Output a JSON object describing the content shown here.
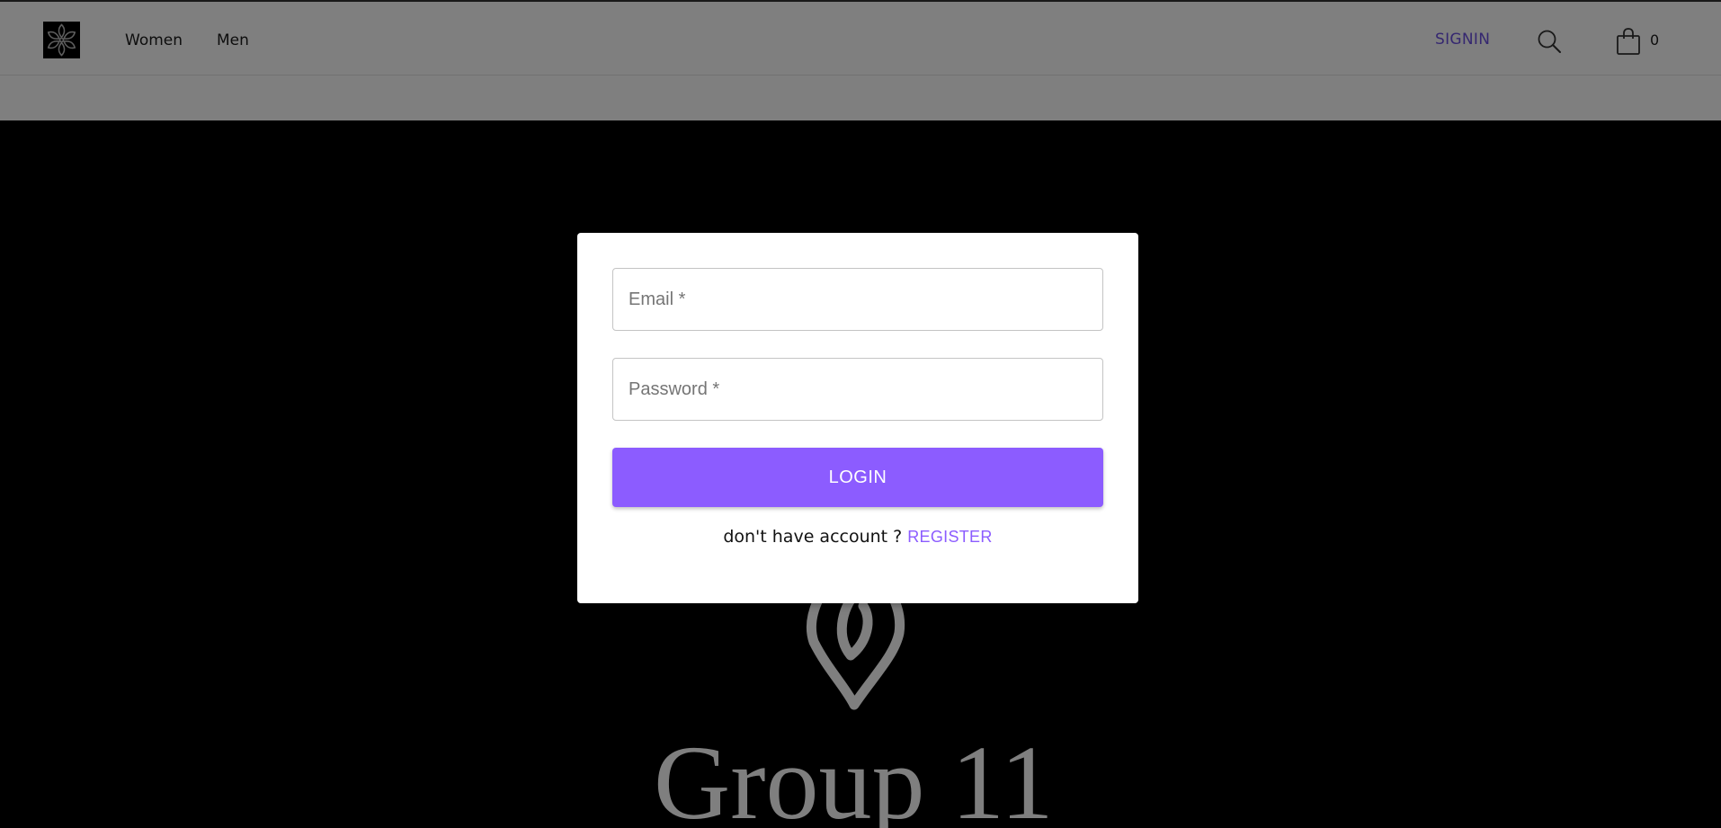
{
  "header": {
    "logo": "flower-logo-icon",
    "nav": [
      {
        "label": "Women"
      },
      {
        "label": "Men"
      }
    ],
    "signin_label": "SIGNIN",
    "search_icon": "search-icon",
    "cart_icon": "shopping-bag-icon",
    "cart_count": "0",
    "accent_color": "#6b4fe0"
  },
  "hero": {
    "emblem": "flower-emblem-icon",
    "brand_title": "Group 11"
  },
  "login_modal": {
    "email_placeholder": "Email *",
    "email_value": "",
    "password_placeholder": "Password *",
    "password_value": "",
    "login_label": "LOGIN",
    "register_prompt": "don't have account ?",
    "register_label": "REGISTER",
    "button_color": "#8c5cff"
  }
}
